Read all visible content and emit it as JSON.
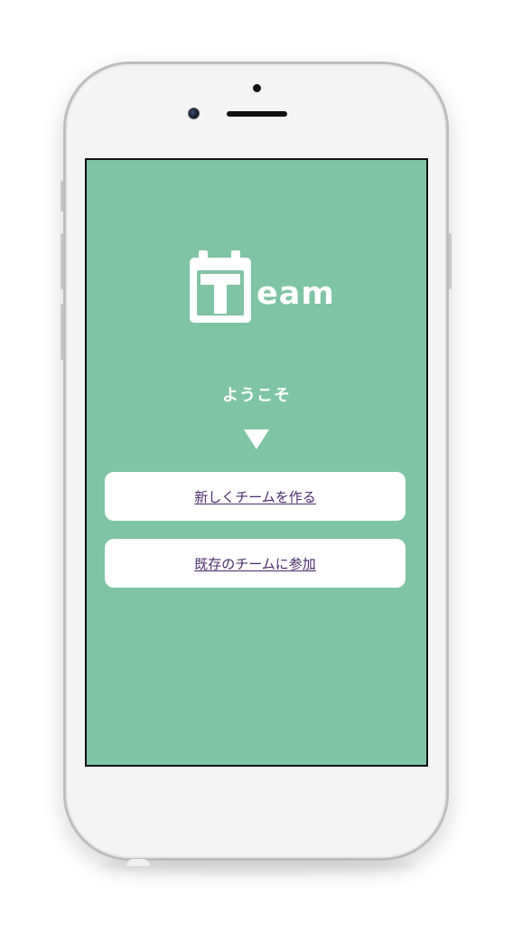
{
  "app": {
    "logo_text": "eam",
    "logo_alt": "Team"
  },
  "welcome": {
    "text": "ようこそ"
  },
  "actions": {
    "create_team_label": "新しくチームを作る",
    "join_team_label": "既存のチームに参加"
  },
  "icons": {
    "logo": "calendar-t-icon",
    "arrow": "triangle-down-icon",
    "camera": "front-camera-icon"
  },
  "colors": {
    "screen_bg": "#7fc4a4",
    "button_bg": "#ffffff",
    "link_text": "#4a2a6a",
    "phone_body": "#f4f4f4"
  }
}
